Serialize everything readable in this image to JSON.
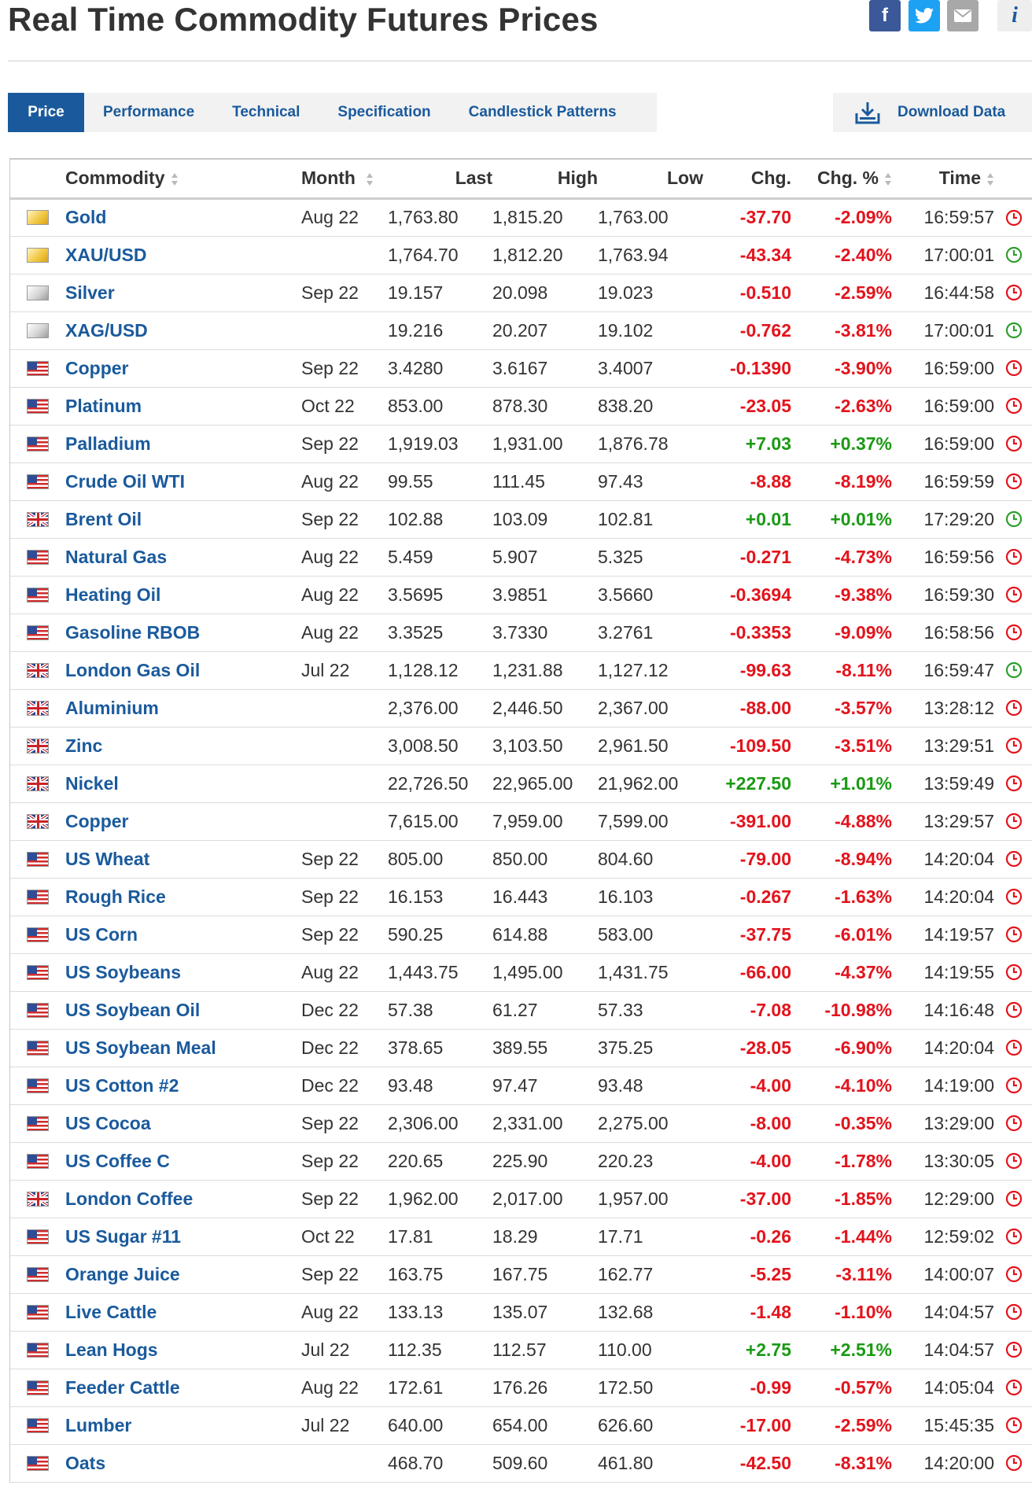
{
  "header": {
    "title": "Real Time Commodity Futures Prices",
    "share": {
      "facebook_glyph": "f",
      "email_icon": "envelope-icon",
      "info_glyph": "i"
    }
  },
  "tabs": [
    {
      "label": "Price",
      "active": true
    },
    {
      "label": "Performance",
      "active": false
    },
    {
      "label": "Technical",
      "active": false
    },
    {
      "label": "Specification",
      "active": false
    },
    {
      "label": "Candlestick Patterns",
      "active": false
    }
  ],
  "download_label": "Download Data",
  "columns": {
    "commodity": "Commodity",
    "month": "Month",
    "last": "Last",
    "high": "High",
    "low": "Low",
    "chg": "Chg.",
    "chg_pct": "Chg. %",
    "time": "Time"
  },
  "colors": {
    "accent": "#1a5a9c",
    "negative": "#e3131c",
    "positive": "#1a9a14",
    "clock_open": "#2e9e2e",
    "clock_closed": "#e3131c"
  },
  "rows": [
    {
      "flag": "gold",
      "name": "Gold",
      "month": "Aug 22",
      "last": "1,763.80",
      "high": "1,815.20",
      "low": "1,763.00",
      "chg": "-37.70",
      "pct": "-2.09%",
      "time": "16:59:57",
      "status": "closed"
    },
    {
      "flag": "gold",
      "name": "XAU/USD",
      "month": "",
      "last": "1,764.70",
      "high": "1,812.20",
      "low": "1,763.94",
      "chg": "-43.34",
      "pct": "-2.40%",
      "time": "17:00:01",
      "status": "open"
    },
    {
      "flag": "silver",
      "name": "Silver",
      "month": "Sep 22",
      "last": "19.157",
      "high": "20.098",
      "low": "19.023",
      "chg": "-0.510",
      "pct": "-2.59%",
      "time": "16:44:58",
      "status": "closed"
    },
    {
      "flag": "silver",
      "name": "XAG/USD",
      "month": "",
      "last": "19.216",
      "high": "20.207",
      "low": "19.102",
      "chg": "-0.762",
      "pct": "-3.81%",
      "time": "17:00:01",
      "status": "open"
    },
    {
      "flag": "us",
      "name": "Copper",
      "month": "Sep 22",
      "last": "3.4280",
      "high": "3.6167",
      "low": "3.4007",
      "chg": "-0.1390",
      "pct": "-3.90%",
      "time": "16:59:00",
      "status": "closed"
    },
    {
      "flag": "us",
      "name": "Platinum",
      "month": "Oct 22",
      "last": "853.00",
      "high": "878.30",
      "low": "838.20",
      "chg": "-23.05",
      "pct": "-2.63%",
      "time": "16:59:00",
      "status": "closed"
    },
    {
      "flag": "us",
      "name": "Palladium",
      "month": "Sep 22",
      "last": "1,919.03",
      "high": "1,931.00",
      "low": "1,876.78",
      "chg": "+7.03",
      "pct": "+0.37%",
      "time": "16:59:00",
      "status": "closed"
    },
    {
      "flag": "us",
      "name": "Crude Oil WTI",
      "month": "Aug 22",
      "last": "99.55",
      "high": "111.45",
      "low": "97.43",
      "chg": "-8.88",
      "pct": "-8.19%",
      "time": "16:59:59",
      "status": "closed"
    },
    {
      "flag": "uk",
      "name": "Brent Oil",
      "month": "Sep 22",
      "last": "102.88",
      "high": "103.09",
      "low": "102.81",
      "chg": "+0.01",
      "pct": "+0.01%",
      "time": "17:29:20",
      "status": "open"
    },
    {
      "flag": "us",
      "name": "Natural Gas",
      "month": "Aug 22",
      "last": "5.459",
      "high": "5.907",
      "low": "5.325",
      "chg": "-0.271",
      "pct": "-4.73%",
      "time": "16:59:56",
      "status": "closed"
    },
    {
      "flag": "us",
      "name": "Heating Oil",
      "month": "Aug 22",
      "last": "3.5695",
      "high": "3.9851",
      "low": "3.5660",
      "chg": "-0.3694",
      "pct": "-9.38%",
      "time": "16:59:30",
      "status": "closed"
    },
    {
      "flag": "us",
      "name": "Gasoline RBOB",
      "month": "Aug 22",
      "last": "3.3525",
      "high": "3.7330",
      "low": "3.2761",
      "chg": "-0.3353",
      "pct": "-9.09%",
      "time": "16:58:56",
      "status": "closed"
    },
    {
      "flag": "uk",
      "name": "London Gas Oil",
      "month": "Jul 22",
      "last": "1,128.12",
      "high": "1,231.88",
      "low": "1,127.12",
      "chg": "-99.63",
      "pct": "-8.11%",
      "time": "16:59:47",
      "status": "open"
    },
    {
      "flag": "uk",
      "name": "Aluminium",
      "month": "",
      "last": "2,376.00",
      "high": "2,446.50",
      "low": "2,367.00",
      "chg": "-88.00",
      "pct": "-3.57%",
      "time": "13:28:12",
      "status": "closed"
    },
    {
      "flag": "uk",
      "name": "Zinc",
      "month": "",
      "last": "3,008.50",
      "high": "3,103.50",
      "low": "2,961.50",
      "chg": "-109.50",
      "pct": "-3.51%",
      "time": "13:29:51",
      "status": "closed"
    },
    {
      "flag": "uk",
      "name": "Nickel",
      "month": "",
      "last": "22,726.50",
      "high": "22,965.00",
      "low": "21,962.00",
      "chg": "+227.50",
      "pct": "+1.01%",
      "time": "13:59:49",
      "status": "closed"
    },
    {
      "flag": "uk",
      "name": "Copper",
      "month": "",
      "last": "7,615.00",
      "high": "7,959.00",
      "low": "7,599.00",
      "chg": "-391.00",
      "pct": "-4.88%",
      "time": "13:29:57",
      "status": "closed"
    },
    {
      "flag": "us",
      "name": "US Wheat",
      "month": "Sep 22",
      "last": "805.00",
      "high": "850.00",
      "low": "804.60",
      "chg": "-79.00",
      "pct": "-8.94%",
      "time": "14:20:04",
      "status": "closed"
    },
    {
      "flag": "us",
      "name": "Rough Rice",
      "month": "Sep 22",
      "last": "16.153",
      "high": "16.443",
      "low": "16.103",
      "chg": "-0.267",
      "pct": "-1.63%",
      "time": "14:20:04",
      "status": "closed"
    },
    {
      "flag": "us",
      "name": "US Corn",
      "month": "Sep 22",
      "last": "590.25",
      "high": "614.88",
      "low": "583.00",
      "chg": "-37.75",
      "pct": "-6.01%",
      "time": "14:19:57",
      "status": "closed"
    },
    {
      "flag": "us",
      "name": "US Soybeans",
      "month": "Aug 22",
      "last": "1,443.75",
      "high": "1,495.00",
      "low": "1,431.75",
      "chg": "-66.00",
      "pct": "-4.37%",
      "time": "14:19:55",
      "status": "closed"
    },
    {
      "flag": "us",
      "name": "US Soybean Oil",
      "month": "Dec 22",
      "last": "57.38",
      "high": "61.27",
      "low": "57.33",
      "chg": "-7.08",
      "pct": "-10.98%",
      "time": "14:16:48",
      "status": "closed"
    },
    {
      "flag": "us",
      "name": "US Soybean Meal",
      "month": "Dec 22",
      "last": "378.65",
      "high": "389.55",
      "low": "375.25",
      "chg": "-28.05",
      "pct": "-6.90%",
      "time": "14:20:04",
      "status": "closed"
    },
    {
      "flag": "us",
      "name": "US Cotton #2",
      "month": "Dec 22",
      "last": "93.48",
      "high": "97.47",
      "low": "93.48",
      "chg": "-4.00",
      "pct": "-4.10%",
      "time": "14:19:00",
      "status": "closed"
    },
    {
      "flag": "us",
      "name": "US Cocoa",
      "month": "Sep 22",
      "last": "2,306.00",
      "high": "2,331.00",
      "low": "2,275.00",
      "chg": "-8.00",
      "pct": "-0.35%",
      "time": "13:29:00",
      "status": "closed"
    },
    {
      "flag": "us",
      "name": "US Coffee C",
      "month": "Sep 22",
      "last": "220.65",
      "high": "225.90",
      "low": "220.23",
      "chg": "-4.00",
      "pct": "-1.78%",
      "time": "13:30:05",
      "status": "closed"
    },
    {
      "flag": "uk",
      "name": "London Coffee",
      "month": "Sep 22",
      "last": "1,962.00",
      "high": "2,017.00",
      "low": "1,957.00",
      "chg": "-37.00",
      "pct": "-1.85%",
      "time": "12:29:00",
      "status": "closed"
    },
    {
      "flag": "us",
      "name": "US Sugar #11",
      "month": "Oct 22",
      "last": "17.81",
      "high": "18.29",
      "low": "17.71",
      "chg": "-0.26",
      "pct": "-1.44%",
      "time": "12:59:02",
      "status": "closed"
    },
    {
      "flag": "us",
      "name": "Orange Juice",
      "month": "Sep 22",
      "last": "163.75",
      "high": "167.75",
      "low": "162.77",
      "chg": "-5.25",
      "pct": "-3.11%",
      "time": "14:00:07",
      "status": "closed"
    },
    {
      "flag": "us",
      "name": "Live Cattle",
      "month": "Aug 22",
      "last": "133.13",
      "high": "135.07",
      "low": "132.68",
      "chg": "-1.48",
      "pct": "-1.10%",
      "time": "14:04:57",
      "status": "closed"
    },
    {
      "flag": "us",
      "name": "Lean Hogs",
      "month": "Jul 22",
      "last": "112.35",
      "high": "112.57",
      "low": "110.00",
      "chg": "+2.75",
      "pct": "+2.51%",
      "time": "14:04:57",
      "status": "closed"
    },
    {
      "flag": "us",
      "name": "Feeder Cattle",
      "month": "Aug 22",
      "last": "172.61",
      "high": "176.26",
      "low": "172.50",
      "chg": "-0.99",
      "pct": "-0.57%",
      "time": "14:05:04",
      "status": "closed"
    },
    {
      "flag": "us",
      "name": "Lumber",
      "month": "Jul 22",
      "last": "640.00",
      "high": "654.00",
      "low": "626.60",
      "chg": "-17.00",
      "pct": "-2.59%",
      "time": "15:45:35",
      "status": "closed"
    },
    {
      "flag": "us",
      "name": "Oats",
      "month": "",
      "last": "468.70",
      "high": "509.60",
      "low": "461.80",
      "chg": "-42.50",
      "pct": "-8.31%",
      "time": "14:20:00",
      "status": "closed"
    }
  ]
}
